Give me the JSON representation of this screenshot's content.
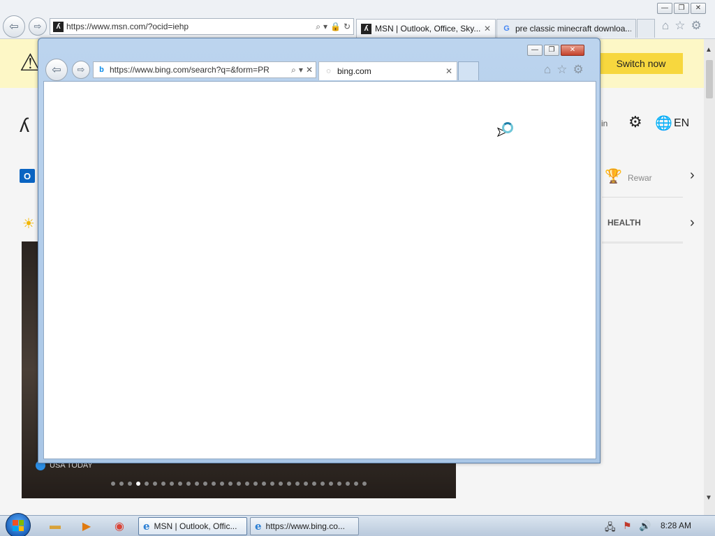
{
  "bg_browser": {
    "address": "https://www.msn.com/?ocid=iehp",
    "tabs": [
      {
        "title": "MSN | Outlook, Office, Sky..."
      },
      {
        "title": "pre classic minecraft downloa..."
      }
    ],
    "caption": {
      "minimize": "—",
      "restore": "❐",
      "close": "✕"
    },
    "banner": {
      "switch_now": "Switch now"
    },
    "header": {
      "signin_fragment": "in",
      "language": "EN"
    },
    "sidebar": {
      "rewards_label": "Rewar",
      "health_label": "HEALTH"
    },
    "hero": {
      "source": "USA TODAY",
      "dot_count": 31,
      "active_dot": 3
    }
  },
  "popup": {
    "address": "https://www.bing.com/search?q=&form=PR",
    "tab": {
      "title": "bing.com"
    },
    "caption": {
      "minimize": "—",
      "restore": "❐",
      "close": "✕"
    }
  },
  "taskbar": {
    "items": [
      {
        "label": "MSN | Outlook, Offic..."
      },
      {
        "label": "https://www.bing.co..."
      }
    ],
    "clock": "8:28 AM"
  },
  "icons": {
    "back": "back-arrow-icon",
    "forward": "forward-arrow-icon",
    "home": "home-icon",
    "favorites": "star-icon",
    "tools": "gear-icon"
  },
  "colors": {
    "banner_bg": "#fdf7c6",
    "switch_button": "#f7d73e",
    "popup_frame": "#bcd4ee",
    "taskbar": "#b9c9dc"
  }
}
